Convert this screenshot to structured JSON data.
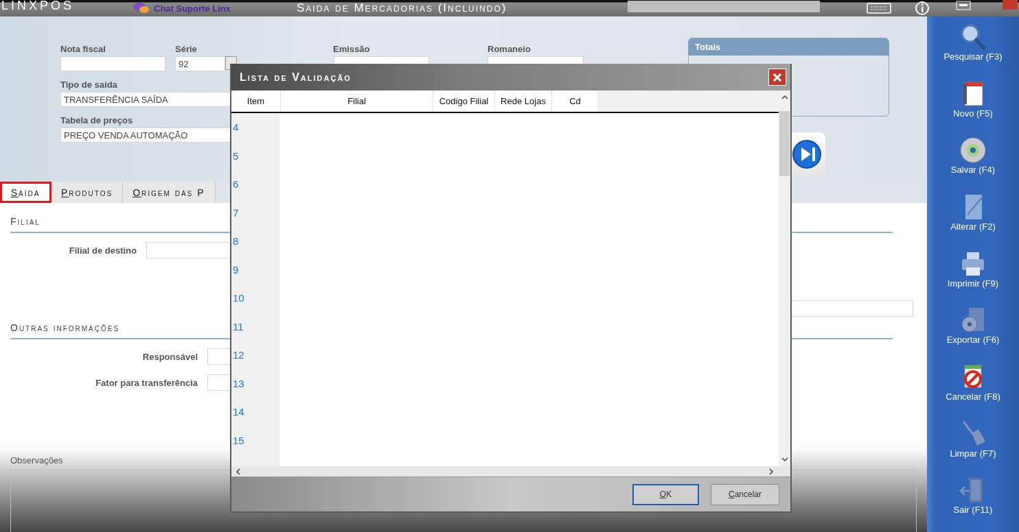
{
  "titlebar": {
    "logo": "LINXPOS",
    "chat": "Chat Suporte Linx",
    "title": "Saida de Mercadorias (Incluindo)"
  },
  "form": {
    "nota_fiscal": {
      "label": "Nota fiscal"
    },
    "serie": {
      "label": "Série",
      "value": "92"
    },
    "emissao": {
      "label": "Emissão"
    },
    "romaneio": {
      "label": "Romaneio"
    },
    "tipo_de_saida": {
      "label": "Tipo de saída",
      "value": "TRANSFERÊNCIA SAÍDA"
    },
    "tabela_de_precos": {
      "label": "Tabela de preços",
      "value": "PREÇO VENDA AUTOMAÇÃO"
    }
  },
  "totais": {
    "title": "Totais"
  },
  "tabs": [
    {
      "label": "Saída",
      "selected": true,
      "highlighted": true
    },
    {
      "label": "Produtos",
      "selected": false,
      "highlighted": false
    },
    {
      "label": "Origem das P",
      "selected": false,
      "highlighted": false
    }
  ],
  "panel": {
    "section_1": "Filial",
    "filial_de_destino": {
      "label": "Filial de destino"
    },
    "section_2": "Outras informações",
    "responsavel": {
      "label": "Responsável"
    },
    "fator": {
      "label": "Fator para transferência"
    },
    "observacoes": {
      "label": "Observações"
    }
  },
  "sidebar": {
    "items": [
      {
        "label": "Pesquisar (F3)"
      },
      {
        "label": "Novo (F5)"
      },
      {
        "label": "Salvar (F4)"
      },
      {
        "label": "Alterar (F2)"
      },
      {
        "label": "Imprimir (F9)"
      },
      {
        "label": "Exportar (F6)"
      },
      {
        "label": "Cancelar (F8)"
      },
      {
        "label": "Limpar (F7)"
      },
      {
        "label": "Sair (F11)"
      }
    ]
  },
  "dialog": {
    "title": "Lista de Validação",
    "columns": [
      "Item",
      "Filial",
      "Codigo Filial",
      "Rede Lojas",
      "Cd"
    ],
    "rows": [
      {
        "item": "4"
      },
      {
        "item": "5"
      },
      {
        "item": "6"
      },
      {
        "item": "7"
      },
      {
        "item": "8"
      },
      {
        "item": "9"
      },
      {
        "item": "10"
      },
      {
        "item": "11"
      },
      {
        "item": "12"
      },
      {
        "item": "13"
      },
      {
        "item": "14"
      },
      {
        "item": "15"
      }
    ],
    "buttons": [
      {
        "label": "OK",
        "default": true
      },
      {
        "label": "Cancelar",
        "default": false
      }
    ]
  }
}
